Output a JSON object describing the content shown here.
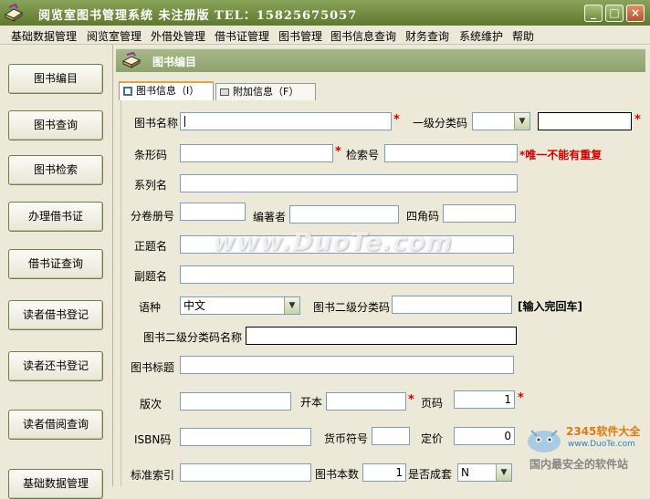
{
  "window": {
    "title": "阅览室图书管理系统 未注册版  TEL：15825675057",
    "minimize": "_",
    "maximize": "□",
    "close": "×"
  },
  "menu": [
    "基础数据管理",
    "阅览室管理",
    "外借处管理",
    "借书证管理",
    "图书管理",
    "图书信息查询",
    "财务查询",
    "系统维护",
    "帮助"
  ],
  "sidebar": [
    "图书编目",
    "图书查询",
    "图书检索",
    "办理借书证",
    "借书证查询",
    "读者借书登记",
    "读者还书登记",
    "读者借阅查询",
    "基础数据管理"
  ],
  "panel": {
    "title": "图书编目"
  },
  "tabs": [
    "图书信息（I）",
    "附加信息（F）"
  ],
  "form": {
    "book_name": {
      "label": "图书名称",
      "value": ""
    },
    "category1": {
      "label": "一级分类码",
      "value": "",
      "text": ""
    },
    "barcode": {
      "label": "条形码",
      "value": ""
    },
    "search_no": {
      "label": "检索号",
      "value": ""
    },
    "unique_note": "*唯一不能有重复",
    "series": {
      "label": "系列名",
      "value": ""
    },
    "volume_no": {
      "label": "分卷册号",
      "value": ""
    },
    "author": {
      "label": "编著者",
      "value": ""
    },
    "four_corner": {
      "label": "四角码",
      "value": ""
    },
    "main_title": {
      "label": "正题名",
      "value": ""
    },
    "sub_title": {
      "label": "副题名",
      "value": ""
    },
    "language": {
      "label": "语种",
      "value": "中文"
    },
    "category2": {
      "label": "图书二级分类码",
      "value": ""
    },
    "enter_hint": "[输入完回车]",
    "category2_name": {
      "label": "图书二级分类码名称",
      "value": ""
    },
    "book_tags": {
      "label": "图书标题",
      "value": ""
    },
    "edition": {
      "label": "版次",
      "value": ""
    },
    "format": {
      "label": "开本",
      "value": ""
    },
    "pages": {
      "label": "页码",
      "value": "1"
    },
    "isbn": {
      "label": "ISBN码",
      "value": ""
    },
    "currency": {
      "label": "货币符号",
      "value": ""
    },
    "price": {
      "label": "定价",
      "value": "0"
    },
    "std_index": {
      "label": "标准索引",
      "value": ""
    },
    "copies": {
      "label": "图书本数",
      "value": "1"
    },
    "is_set": {
      "label": "是否成套",
      "value": "N"
    }
  },
  "watermark": "www.DuoTe.com",
  "logo": {
    "brand": "2345软件大全",
    "url": "www.DuoTe.com",
    "slogan": "国内最安全的软件站"
  },
  "colors": {
    "titlebar": "#6f8a3e",
    "panel_header": "#97a876",
    "required": "#d00000"
  }
}
